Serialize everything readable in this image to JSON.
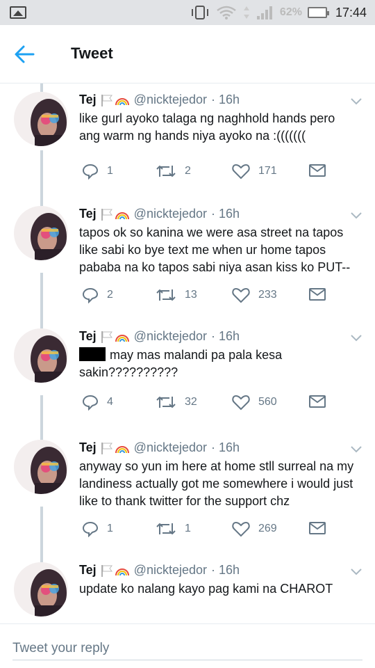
{
  "status_bar": {
    "battery": "62%",
    "time": "17:44"
  },
  "header": {
    "title": "Tweet"
  },
  "tweets": [
    {
      "name": "Tej",
      "handle": "@nicktejedor",
      "time": "· 16h",
      "text": "like gurl ayoko talaga ng naghhold hands pero ang warm ng hands niya ayoko na :(((((((",
      "replies": "1",
      "retweets": "2",
      "likes": "171"
    },
    {
      "name": "Tej",
      "handle": "@nicktejedor",
      "time": "· 16h",
      "text": "tapos ok so kanina we were asa street na tapos like sabi ko bye text me when ur home tapos pababa na ko tapos sabi niya asan kiss ko PUT--",
      "replies": "2",
      "retweets": "13",
      "likes": "233"
    },
    {
      "name": "Tej",
      "handle": "@nicktejedor",
      "time": "· 16h",
      "text": "may mas malandi pa pala kesa sakin??????????",
      "replies": "4",
      "retweets": "32",
      "likes": "560"
    },
    {
      "name": "Tej",
      "handle": "@nicktejedor",
      "time": "· 16h",
      "text": "anyway so yun im here at home stll surreal na my landiness actually got me somewhere i would just like to thank twitter for the support chz",
      "replies": "1",
      "retweets": "1",
      "likes": "269"
    },
    {
      "name": "Tej",
      "handle": "@nicktejedor",
      "time": "· 16h",
      "text": "update ko nalang kayo pag kami na CHAROT"
    }
  ],
  "reply": {
    "placeholder": "Tweet your reply"
  },
  "colors": {
    "accent": "#1da1f2",
    "secondary_text": "#657786",
    "thread_line": "#ccd6dd"
  }
}
